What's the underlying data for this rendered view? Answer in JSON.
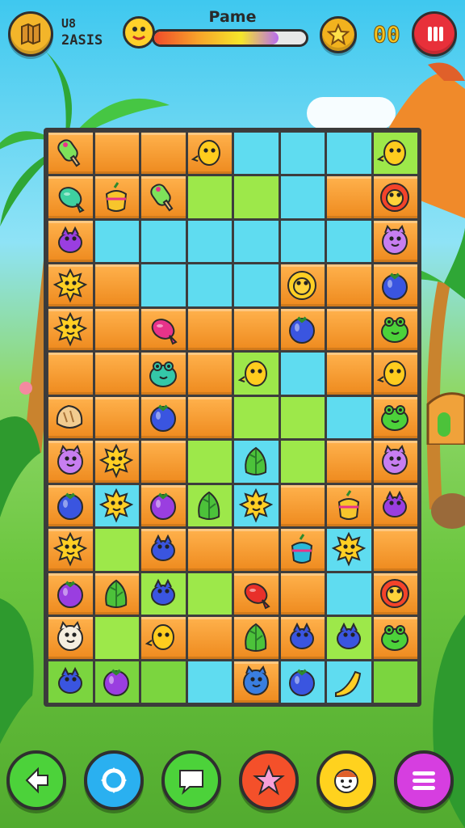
{
  "hud": {
    "title": "Pame",
    "stat_top": "U8",
    "stat_bottom": "2ASIS",
    "star_count": "00",
    "progress": 0.82,
    "progress_colors": [
      "#f04b2a",
      "#f7a22a",
      "#f5e62a",
      "#b86cf0"
    ]
  },
  "colors": {
    "orange_tile": "#f59a2c",
    "cyan_tile": "#5fdcf0",
    "lime_tile": "#9de84a",
    "board_border": "#3b3b3b",
    "pause_button": "#e8303a",
    "star_button": "#f2b21e"
  },
  "board": {
    "cols": 8,
    "rows": 13,
    "tiles": [
      "oooocccl",
      "ooollcoo",
      "occcccco",
      "oocccooo",
      "oooooooo",
      "oooolcoo",
      "oooollco",
      "ooolcloo",
      "ocolcooo",
      "olooooco",
      "oollooco",
      "oloooolo",
      "gggcoccg"
    ],
    "pieces": [
      {
        "r": 0,
        "c": 0,
        "icon": "popsicle-icon",
        "color": "#7ee25a"
      },
      {
        "r": 0,
        "c": 3,
        "icon": "chick-icon",
        "color": "#ffcc1e"
      },
      {
        "r": 0,
        "c": 7,
        "icon": "chick-icon",
        "color": "#ffcc1e"
      },
      {
        "r": 1,
        "c": 0,
        "icon": "candy-icon",
        "color": "#3ed0a0"
      },
      {
        "r": 1,
        "c": 1,
        "icon": "pot-icon",
        "color": "#f7c52c"
      },
      {
        "r": 1,
        "c": 2,
        "icon": "popsicle-icon",
        "color": "#7ee25a"
      },
      {
        "r": 1,
        "c": 7,
        "icon": "sunflower-icon",
        "color": "#f4432a"
      },
      {
        "r": 2,
        "c": 0,
        "icon": "bird-icon",
        "color": "#9a3ee0"
      },
      {
        "r": 2,
        "c": 7,
        "icon": "pig-icon",
        "color": "#c77ef0"
      },
      {
        "r": 3,
        "c": 0,
        "icon": "sun-icon",
        "color": "#ffcf24"
      },
      {
        "r": 3,
        "c": 5,
        "icon": "sunflower-icon",
        "color": "#ffcf24"
      },
      {
        "r": 3,
        "c": 7,
        "icon": "berry-icon",
        "color": "#3a55e0"
      },
      {
        "r": 4,
        "c": 0,
        "icon": "sun-icon",
        "color": "#ffcf24"
      },
      {
        "r": 4,
        "c": 2,
        "icon": "candy-icon",
        "color": "#e8338a"
      },
      {
        "r": 4,
        "c": 5,
        "icon": "berry-icon",
        "color": "#3a55e0"
      },
      {
        "r": 4,
        "c": 7,
        "icon": "frog-icon",
        "color": "#4cd23a"
      },
      {
        "r": 5,
        "c": 2,
        "icon": "frog-icon",
        "color": "#34c7a8"
      },
      {
        "r": 5,
        "c": 4,
        "icon": "chick-icon",
        "color": "#ffcc1e"
      },
      {
        "r": 5,
        "c": 7,
        "icon": "chick-icon",
        "color": "#ffcc1e"
      },
      {
        "r": 6,
        "c": 0,
        "icon": "bread-icon",
        "color": "#f2cc90"
      },
      {
        "r": 6,
        "c": 2,
        "icon": "berry-icon",
        "color": "#3a55e0"
      },
      {
        "r": 6,
        "c": 7,
        "icon": "frog-icon",
        "color": "#4cd23a"
      },
      {
        "r": 7,
        "c": 0,
        "icon": "pig-icon",
        "color": "#c77ef0"
      },
      {
        "r": 7,
        "c": 1,
        "icon": "sun-icon",
        "color": "#ffcf24"
      },
      {
        "r": 7,
        "c": 4,
        "icon": "leaf-icon",
        "color": "#4cc23a"
      },
      {
        "r": 7,
        "c": 7,
        "icon": "pig-icon",
        "color": "#c77ef0"
      },
      {
        "r": 8,
        "c": 0,
        "icon": "berry-icon",
        "color": "#3a55e0"
      },
      {
        "r": 8,
        "c": 1,
        "icon": "sun-icon",
        "color": "#ffcf24"
      },
      {
        "r": 8,
        "c": 2,
        "icon": "berry-icon",
        "color": "#9a3ee0"
      },
      {
        "r": 8,
        "c": 3,
        "icon": "leaf-icon",
        "color": "#4cc23a"
      },
      {
        "r": 8,
        "c": 4,
        "icon": "sun-icon",
        "color": "#ffcf24"
      },
      {
        "r": 8,
        "c": 6,
        "icon": "pot-icon",
        "color": "#f7c52c"
      },
      {
        "r": 8,
        "c": 7,
        "icon": "bird-icon",
        "color": "#9a3ee0"
      },
      {
        "r": 9,
        "c": 0,
        "icon": "sun-icon",
        "color": "#ffcf24"
      },
      {
        "r": 9,
        "c": 2,
        "icon": "bird-icon",
        "color": "#3a55e0"
      },
      {
        "r": 9,
        "c": 5,
        "icon": "pot-icon",
        "color": "#2ab9d8"
      },
      {
        "r": 9,
        "c": 6,
        "icon": "sun-icon",
        "color": "#ffcf24"
      },
      {
        "r": 10,
        "c": 0,
        "icon": "berry-icon",
        "color": "#9a3ee0"
      },
      {
        "r": 10,
        "c": 1,
        "icon": "leaf-icon",
        "color": "#4cc23a"
      },
      {
        "r": 10,
        "c": 2,
        "icon": "bird-icon",
        "color": "#3a55e0"
      },
      {
        "r": 10,
        "c": 4,
        "icon": "candy-icon",
        "color": "#e8302a"
      },
      {
        "r": 10,
        "c": 7,
        "icon": "sunflower-icon",
        "color": "#f4432a"
      },
      {
        "r": 11,
        "c": 0,
        "icon": "pig-icon",
        "color": "#f5eee0"
      },
      {
        "r": 11,
        "c": 2,
        "icon": "chick-icon",
        "color": "#ffcc1e"
      },
      {
        "r": 11,
        "c": 4,
        "icon": "leaf-icon",
        "color": "#4cc23a"
      },
      {
        "r": 11,
        "c": 5,
        "icon": "bird-icon",
        "color": "#3a55e0"
      },
      {
        "r": 11,
        "c": 6,
        "icon": "bird-icon",
        "color": "#3a55e0"
      },
      {
        "r": 11,
        "c": 7,
        "icon": "frog-icon",
        "color": "#4cd23a"
      },
      {
        "r": 12,
        "c": 0,
        "icon": "bird-icon",
        "color": "#3a55e0"
      },
      {
        "r": 12,
        "c": 1,
        "icon": "berry-icon",
        "color": "#9a3ee0"
      },
      {
        "r": 12,
        "c": 4,
        "icon": "pig-icon",
        "color": "#3a7ee0"
      },
      {
        "r": 12,
        "c": 5,
        "icon": "berry-icon",
        "color": "#3a55e0"
      },
      {
        "r": 12,
        "c": 6,
        "icon": "banana-icon",
        "color": "#ffcf24"
      }
    ]
  },
  "bottom_bar": [
    {
      "name": "back-button",
      "icon": "arrow-left-icon",
      "color": "#4cd23a"
    },
    {
      "name": "refresh-button",
      "icon": "gear-refresh-icon",
      "color": "#2ab0f0"
    },
    {
      "name": "chat-button",
      "icon": "speech-bubble-icon",
      "color": "#4cd23a"
    },
    {
      "name": "favorite-button",
      "icon": "star-icon",
      "color": "#f4502a"
    },
    {
      "name": "character-button",
      "icon": "face-icon",
      "color": "#ffd21e"
    },
    {
      "name": "menu-button",
      "icon": "hamburger-icon",
      "color": "#d63ee0"
    }
  ]
}
